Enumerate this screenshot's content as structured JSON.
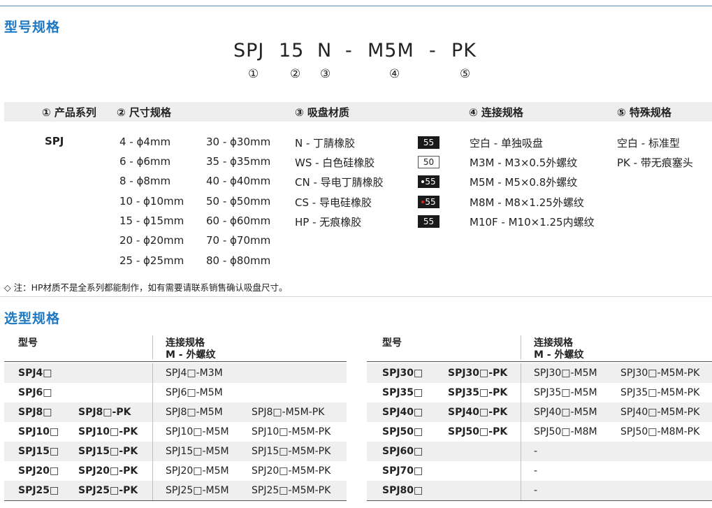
{
  "section1_title": "型号规格",
  "model_code": {
    "series": "SPJ",
    "size": "15",
    "material": "N",
    "dash1": "-",
    "connection": "M5M",
    "dash2": "-",
    "special": "PK"
  },
  "model_nums": [
    "①",
    "②",
    "③",
    "④",
    "⑤"
  ],
  "headers": [
    "① 产品系列",
    "② 尺寸规格",
    "③ 吸盘材质",
    "④ 连接规格",
    "⑤ 特殊规格"
  ],
  "series_value": "SPJ",
  "sizes_col1": [
    "4  - ϕ4mm",
    "6  - ϕ6mm",
    "8  - ϕ8mm",
    "10 - ϕ10mm",
    "15 - ϕ15mm",
    "20 - ϕ20mm",
    "25 - ϕ25mm"
  ],
  "sizes_col2": [
    "30 - ϕ30mm",
    "35 - ϕ35mm",
    "40 - ϕ40mm",
    "50 - ϕ50mm",
    "60 - ϕ60mm",
    "70 - ϕ70mm",
    "80 - ϕ80mm"
  ],
  "materials": [
    {
      "label": "N   - 丁腈橡胶",
      "badge": "55",
      "style": "dark",
      "dot": ""
    },
    {
      "label": "WS - 白色硅橡胶",
      "badge": "50",
      "style": "light",
      "dot": ""
    },
    {
      "label": "CN - 导电丁腈橡胶",
      "badge": "55",
      "style": "dark",
      "dot": "#ffffff"
    },
    {
      "label": "CS  - 导电硅橡胶",
      "badge": "55",
      "style": "dark",
      "dot": "#e02020"
    },
    {
      "label": "HP - 无痕橡胶",
      "badge": "55",
      "style": "dark",
      "dot": ""
    }
  ],
  "connections": [
    "空白  - 单独吸盘",
    "M3M - M3×0.5外螺纹",
    "M5M - M5×0.8外螺纹",
    "M8M - M8×1.25外螺纹",
    "M10F - M10×1.25内螺纹"
  ],
  "specials": [
    "空白 - 标准型",
    "PK   - 带无痕塞头"
  ],
  "note": "◇ 注：HP材质不是全系列都能制作，如有需要请联系销售确认吸盘尺寸。",
  "section2_title": "选型规格",
  "table_headers": {
    "model": "型号",
    "conn1": "连接规格",
    "conn2": "M - 外螺纹"
  },
  "left_rows": [
    [
      "SPJ4□",
      "",
      "SPJ4□-M3M",
      ""
    ],
    [
      "SPJ6□",
      "",
      "SPJ6□-M5M",
      ""
    ],
    [
      "SPJ8□",
      "SPJ8□-PK",
      "SPJ8□-M5M",
      "SPJ8□-M5M-PK"
    ],
    [
      "SPJ10□",
      "SPJ10□-PK",
      "SPJ10□-M5M",
      "SPJ10□-M5M-PK"
    ],
    [
      "SPJ15□",
      "SPJ15□-PK",
      "SPJ15□-M5M",
      "SPJ15□-M5M-PK"
    ],
    [
      "SPJ20□",
      "SPJ20□-PK",
      "SPJ20□-M5M",
      "SPJ20□-M5M-PK"
    ],
    [
      "SPJ25□",
      "SPJ25□-PK",
      "SPJ25□-M5M",
      "SPJ25□-M5M-PK"
    ]
  ],
  "right_rows": [
    [
      "SPJ30□",
      "SPJ30□-PK",
      "SPJ30□-M5M",
      "SPJ30□-M5M-PK"
    ],
    [
      "SPJ35□",
      "SPJ35□-PK",
      "SPJ35□-M5M",
      "SPJ35□-M5M-PK"
    ],
    [
      "SPJ40□",
      "SPJ40□-PK",
      "SPJ40□-M5M",
      "SPJ40□-M5M-PK"
    ],
    [
      "SPJ50□",
      "SPJ50□-PK",
      "SPJ50□-M8M",
      "SPJ50□-M8M-PK"
    ],
    [
      "SPJ60□",
      "",
      "-",
      ""
    ],
    [
      "SPJ70□",
      "",
      "-",
      ""
    ],
    [
      "SPJ80□",
      "",
      "-",
      ""
    ]
  ]
}
